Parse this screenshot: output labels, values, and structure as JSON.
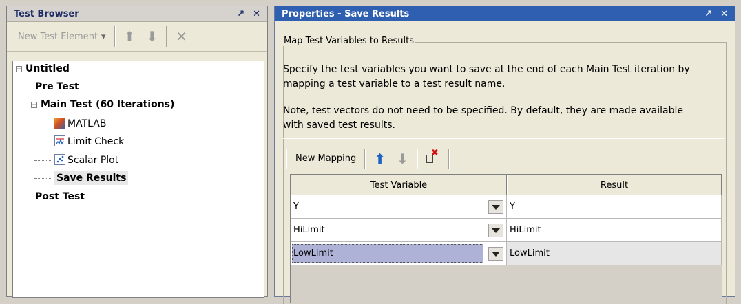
{
  "browser": {
    "title": "Test Browser",
    "pin": "↗",
    "close": "✕",
    "toolbar": {
      "new_element": "New Test Element",
      "chevron": "▾",
      "up": "⬆",
      "down": "⬇",
      "delete": "✕"
    },
    "tree": {
      "root": "Untitled",
      "pre_test": "Pre Test",
      "main_test": "Main Test (60 Iterations)",
      "matlab": "MATLAB",
      "limit_check": "Limit Check",
      "scalar_plot": "Scalar Plot",
      "save_results": "Save Results",
      "post_test": "Post Test",
      "expanded_glyph": "−"
    }
  },
  "properties": {
    "title": "Properties - Save Results",
    "pin": "↗",
    "close": "✕",
    "group_label": "Map Test Variables to Results",
    "desc1_line1": "Specify the test variables you want to save at the end of each Main Test iteration by",
    "desc1_line2": "mapping a test variable to a test result name.",
    "desc2_line1": "Note, test vectors do not need to be specified. By default, they are made available",
    "desc2_line2": "with saved test results.",
    "toolbar": {
      "new_mapping": "New Mapping",
      "up": "⬆",
      "down": "⬇",
      "delete_glyph": "✖"
    },
    "table": {
      "headers": [
        "Test Variable",
        "Result"
      ],
      "rows": [
        {
          "variable": "Y",
          "result": "Y"
        },
        {
          "variable": "HiLimit",
          "result": "HiLimit"
        },
        {
          "variable": "LowLimit",
          "result": "LowLimit"
        }
      ]
    }
  },
  "colors": {
    "selection": "#aeb2d6",
    "title_blue": "#2f5fb0",
    "arrow_blue": "#1f62c4"
  }
}
